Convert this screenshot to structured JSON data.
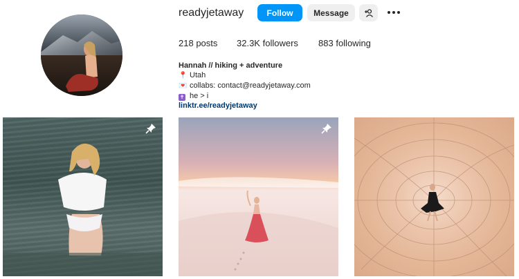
{
  "profile": {
    "username": "readyjetaway",
    "follow_label": "Follow",
    "message_label": "Message",
    "stats": {
      "posts_count": "218",
      "posts_label": "posts",
      "followers_count": "32.3K",
      "followers_label": "followers",
      "following_count": "883",
      "following_label": "following"
    },
    "bio": {
      "name": "Hannah // hiking + adventure",
      "line1": "Utah",
      "line2": "collabs: contact@readyjetaway.com",
      "line3": "he > i",
      "link": "linktr.ee/readyjetaway"
    }
  },
  "posts": [
    {
      "pinned": true
    },
    {
      "pinned": true
    },
    {
      "pinned": false
    }
  ],
  "colors": {
    "follow_button": "#0095f6",
    "secondary_button": "#efefef",
    "link": "#00376b"
  }
}
